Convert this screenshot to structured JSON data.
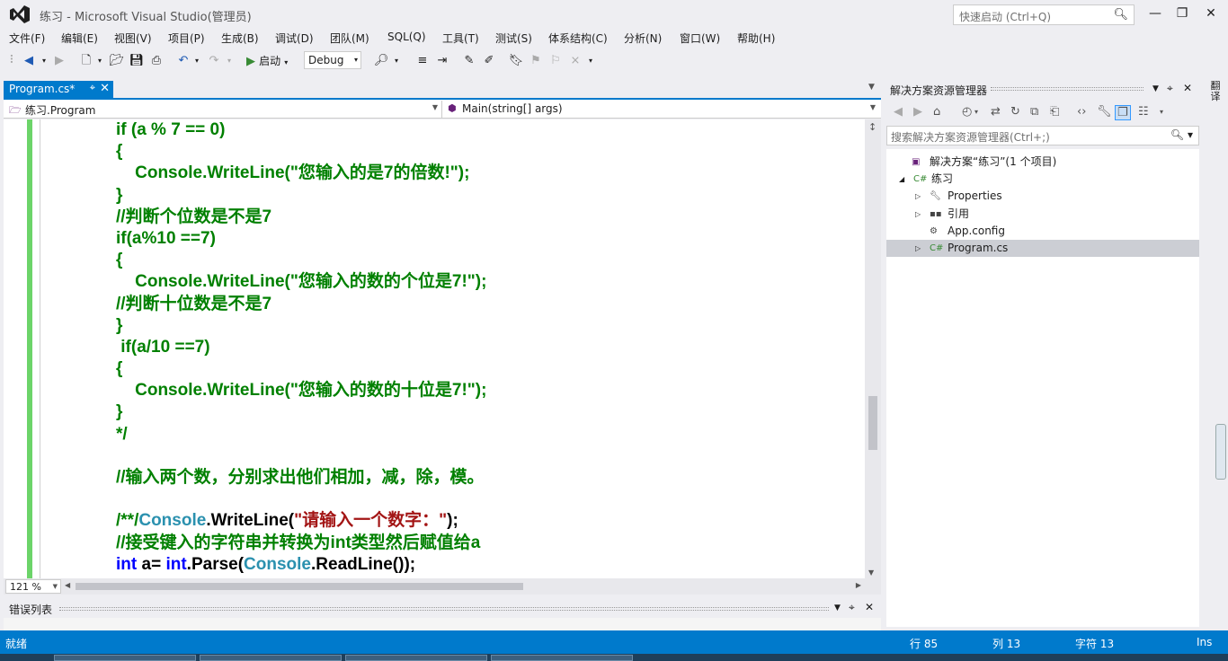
{
  "window": {
    "title": "练习 - Microsoft Visual Studio(管理员)",
    "quick_launch_placeholder": "快速启动 (Ctrl+Q)",
    "brand_color": "#68217a"
  },
  "menu": [
    "文件(F)",
    "编辑(E)",
    "视图(V)",
    "项目(P)",
    "生成(B)",
    "调试(D)",
    "团队(M)",
    "SQL(Q)",
    "工具(T)",
    "测试(S)",
    "体系结构(C)",
    "分析(N)",
    "窗口(W)",
    "帮助(H)"
  ],
  "toolbar": {
    "start_label": "启动",
    "config_value": "Debug"
  },
  "document": {
    "tab_label": "Program.cs*",
    "nav_class": "练习.Program",
    "nav_member": "Main(string[] args)",
    "zoom": "121 %"
  },
  "code_lines": [
    [
      {
        "t": "if (a % 7 == 0)",
        "c": "green"
      }
    ],
    [
      {
        "t": "{",
        "c": "green"
      }
    ],
    [
      {
        "t": "    Console.WriteLine(\"您输入的是7的倍数!\");",
        "c": "green"
      }
    ],
    [
      {
        "t": "}",
        "c": "green"
      }
    ],
    [
      {
        "t": "//判断个位数是不是7",
        "c": "green"
      }
    ],
    [
      {
        "t": "if(a%10 ==7)",
        "c": "green"
      }
    ],
    [
      {
        "t": "{",
        "c": "green"
      }
    ],
    [
      {
        "t": "    Console.WriteLine(\"您输入的数的个位是7!\");",
        "c": "green"
      }
    ],
    [
      {
        "t": "//判断十位数是不是7",
        "c": "green"
      }
    ],
    [
      {
        "t": "}",
        "c": "green"
      }
    ],
    [
      {
        "t": " if(a/10 ==7)",
        "c": "green"
      }
    ],
    [
      {
        "t": "{",
        "c": "green"
      }
    ],
    [
      {
        "t": "    Console.WriteLine(\"您输入的数的十位是7!\");",
        "c": "green"
      }
    ],
    [
      {
        "t": "}",
        "c": "green"
      }
    ],
    [
      {
        "t": "*/",
        "c": "green"
      }
    ],
    [
      {
        "t": "",
        "c": "green"
      }
    ],
    [
      {
        "t": "//输入两个数，分别求出他们相加，减，除，模。",
        "c": "green"
      }
    ],
    [
      {
        "t": "",
        "c": "green"
      }
    ],
    [
      {
        "t": "/**/",
        "c": "green"
      },
      {
        "t": "Console",
        "c": "teal"
      },
      {
        "t": ".WriteLine(",
        "c": "black"
      },
      {
        "t": "\"请输入一个数字：\"",
        "c": "red"
      },
      {
        "t": ");",
        "c": "black"
      }
    ],
    [
      {
        "t": "//接受键入的字符串并转换为int类型然后赋值给a",
        "c": "green"
      }
    ],
    [
      {
        "t": "int",
        "c": "blue"
      },
      {
        "t": " a= ",
        "c": "black"
      },
      {
        "t": "int",
        "c": "blue"
      },
      {
        "t": ".Parse(",
        "c": "black"
      },
      {
        "t": "Console",
        "c": "teal"
      },
      {
        "t": ".ReadLine());",
        "c": "black"
      }
    ]
  ],
  "error_list": {
    "title": "错误列表"
  },
  "solution_explorer": {
    "title": "解决方案资源管理器",
    "search_placeholder": "搜索解决方案资源管理器(Ctrl+;)",
    "items": [
      {
        "label": "解决方案“练习”(1 个项目)",
        "icon": "solution-icon",
        "level": 0,
        "expander": "none",
        "selected": false
      },
      {
        "label": "练习",
        "icon": "csharp-project-icon",
        "level": 1,
        "expander": "expanded",
        "selected": false
      },
      {
        "label": "Properties",
        "icon": "wrench-icon",
        "level": 2,
        "expander": "collapsed",
        "selected": false
      },
      {
        "label": "引用",
        "icon": "references-icon",
        "level": 2,
        "expander": "collapsed",
        "selected": false
      },
      {
        "label": "App.config",
        "icon": "config-file-icon",
        "level": 2,
        "expander": "none",
        "selected": false
      },
      {
        "label": "Program.cs",
        "icon": "csharp-file-icon",
        "level": 2,
        "expander": "collapsed",
        "selected": true
      }
    ]
  },
  "side_strip": {
    "tab_label": "翻译"
  },
  "status_bar": {
    "state": "就绪",
    "line": "行 85",
    "column": "列 13",
    "char": "字符 13",
    "mode": "Ins",
    "accent": "#007acc"
  }
}
